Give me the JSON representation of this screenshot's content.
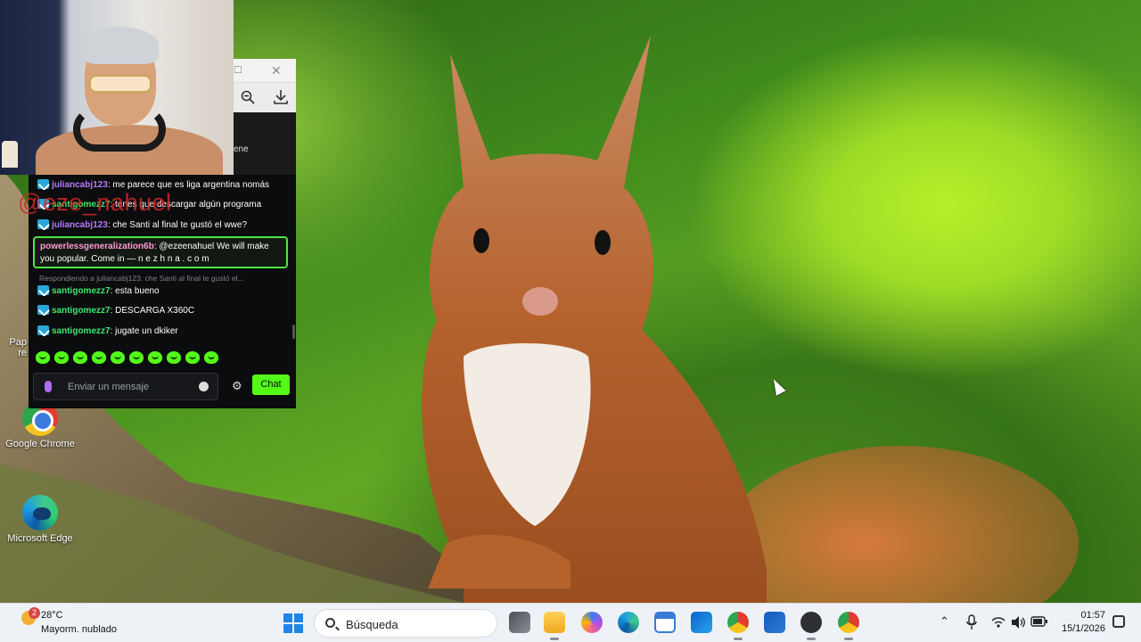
{
  "desktop": {
    "icons": [
      {
        "label": "Google Chrome",
        "icon": "chrome-icon"
      },
      {
        "label": "Microsoft Edge",
        "icon": "edge-icon"
      }
    ],
    "partial_icon_label_1": "Pap",
    "partial_icon_label_2": "re"
  },
  "overlay": {
    "watermark": "@eze_nahuel"
  },
  "window": {
    "partial_text": "ene",
    "close_glyph": "✕",
    "maximize_glyph": "☐"
  },
  "chat": {
    "messages": [
      {
        "user": "juliancabj123",
        "text": ": me parece que es liga argentina nomás"
      },
      {
        "user": "santigomezz7",
        "text": ": tenes que descargar algún programa"
      },
      {
        "user": "juliancabj123",
        "text": ": che Santi al final te gustó el wwe?"
      }
    ],
    "highlighted": {
      "user": "powerlessgeneralization6b",
      "text": ": @ezeenahuel We will make you popular. Come in — n e z h n a . c o m"
    },
    "reply_context": "Respondiendo a juliancabj123: che Santi al final te gustó el...",
    "messages_after": [
      {
        "user": "santigomezz7",
        "text": ": esta bueno"
      },
      {
        "user": "santigomezz7",
        "text": ": DESCARGA X360C"
      },
      {
        "user": "santigomezz7",
        "text": ": jugate un dkiker"
      }
    ],
    "emote_count": 10,
    "input_placeholder": "Enviar un mensaje",
    "send_label": "Chat",
    "accent_color": "#53fc18"
  },
  "taskbar": {
    "weather": {
      "badge": "2",
      "temp": "28°C",
      "desc": "Mayorm. nublado"
    },
    "search_placeholder": "Búsqueda",
    "apps": [
      "task-view-icon",
      "file-explorer-icon",
      "copilot-icon",
      "edge-icon",
      "store-icon",
      "outlook-icon",
      "chrome-icon",
      "word-icon",
      "obs-icon",
      "chrome-profile-icon"
    ],
    "clock": {
      "time": "01:57",
      "date": "15/1/2026"
    }
  }
}
